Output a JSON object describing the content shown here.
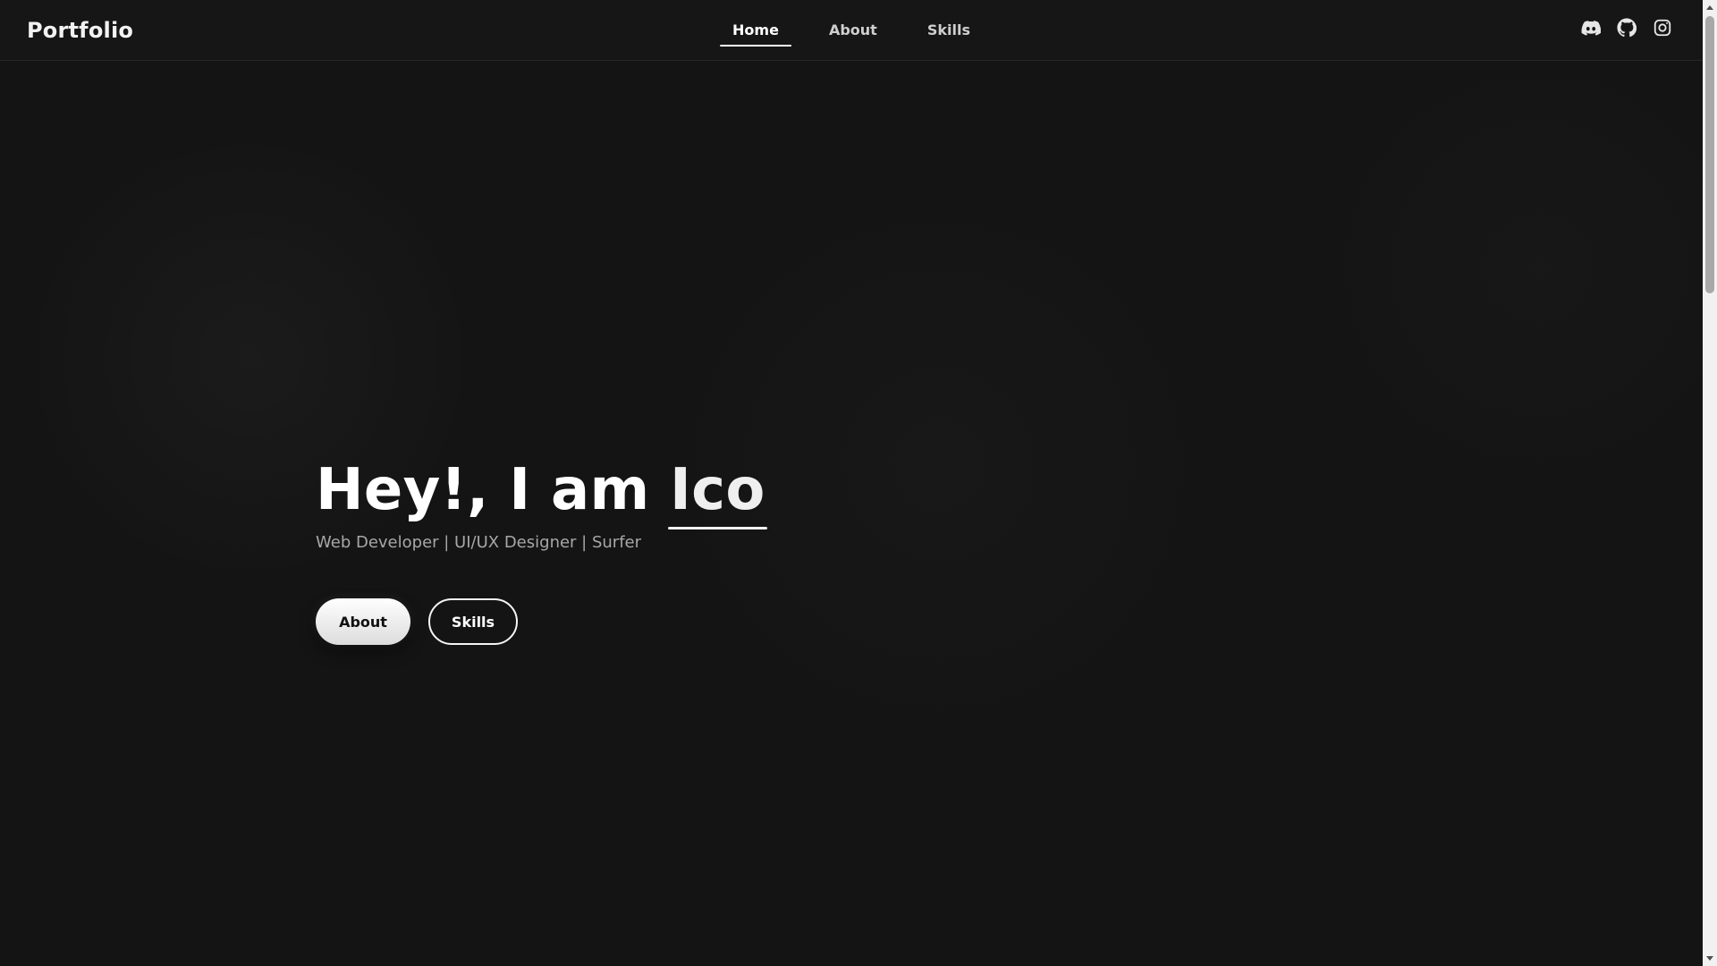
{
  "brand": {
    "name": "Portfolio"
  },
  "nav": {
    "items": [
      {
        "label": "Home",
        "active": true
      },
      {
        "label": "About",
        "active": false
      },
      {
        "label": "Skills",
        "active": false
      }
    ]
  },
  "social": {
    "icons": [
      "discord-icon",
      "github-icon",
      "instagram-icon"
    ]
  },
  "hero": {
    "title_prefix": "Hey!, I am ",
    "name": "Ico",
    "subtitle": "Web Developer | UI/UX Designer | Surfer",
    "buttons": {
      "about_label": "About",
      "skills_label": "Skills"
    }
  },
  "colors": {
    "background": "#141414",
    "text_primary": "#ffffff",
    "text_secondary": "#a7a7a7"
  }
}
